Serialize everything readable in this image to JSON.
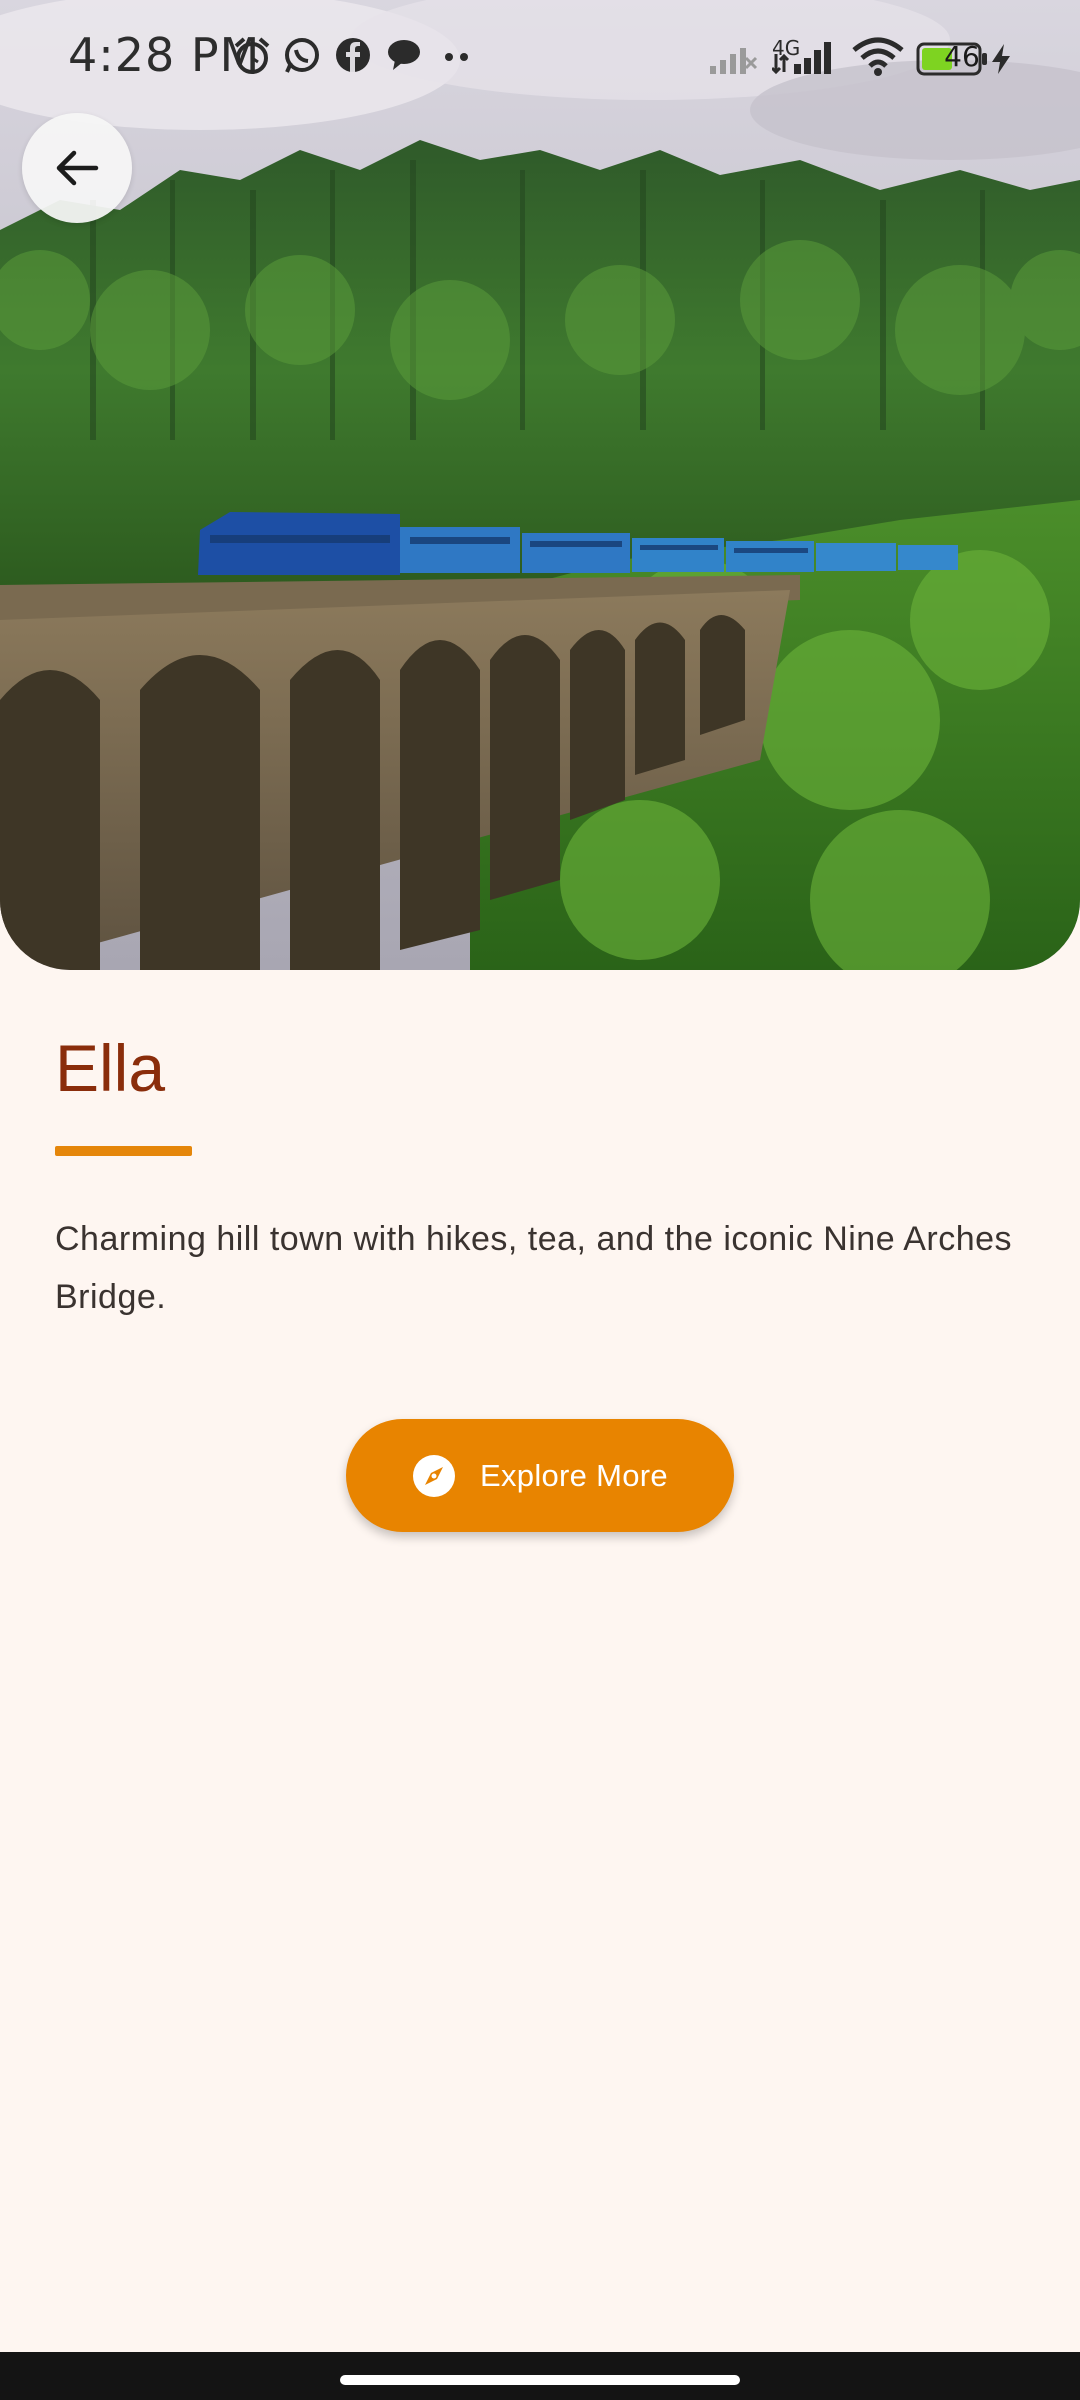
{
  "status_bar": {
    "time": "4:28 PM",
    "network_label": "4G",
    "battery_level": "46",
    "icons": [
      "alarm-icon",
      "whatsapp-icon",
      "facebook-icon",
      "chat-bubble-icon",
      "more-dots-icon",
      "signal-off-icon",
      "signal-icon",
      "wifi-icon",
      "battery-icon",
      "charging-icon"
    ]
  },
  "hero": {
    "image_description_icon": "train-on-nine-arches-bridge-image"
  },
  "back_button": {
    "icon": "arrow-left-icon"
  },
  "destination": {
    "title": "Ella",
    "description": "Charming hill town with hikes, tea, and the iconic Nine Arches Bridge."
  },
  "explore_button": {
    "label": "Explore More",
    "icon": "compass-icon"
  },
  "colors": {
    "background": "#FEF6F1",
    "title": "#8A2D0B",
    "accent": "#E88400",
    "text": "#3a3330"
  }
}
